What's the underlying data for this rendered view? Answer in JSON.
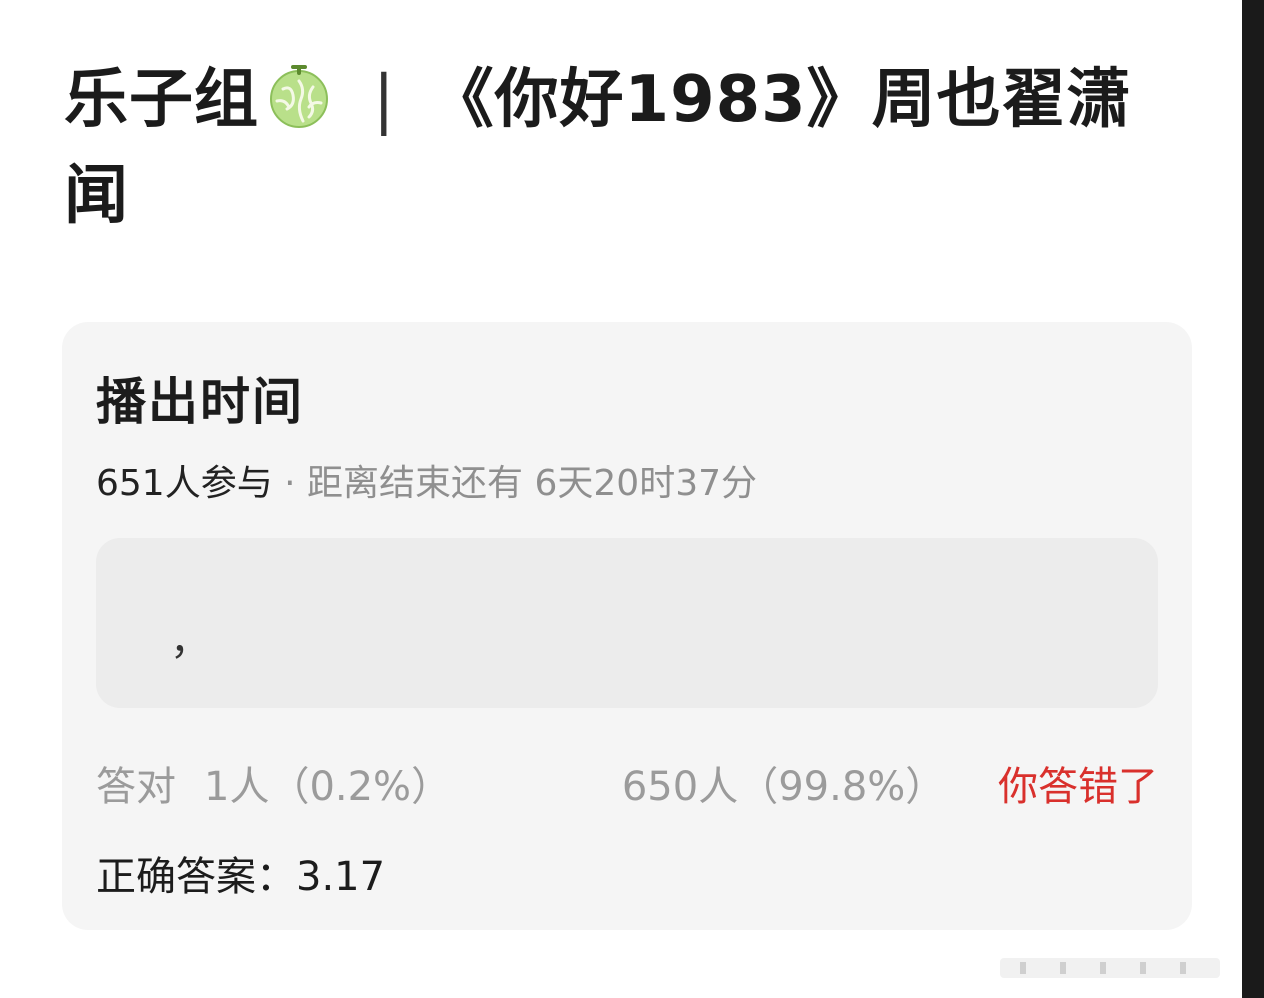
{
  "title": {
    "prefix": "乐子组",
    "icon": "melon-icon",
    "separator": "|",
    "text": "《你好1983》周也翟潇闻"
  },
  "poll": {
    "title": "播出时间",
    "participants": "651人参与",
    "remaining": "· 距离结束还有 6天20时37分",
    "option_text": "，",
    "correct_label": "答对",
    "correct_count": "1人（0.2%）",
    "wrong_count": "650人（99.8%）",
    "wrong_label": "你答错了",
    "answer": "正确答案：3.17"
  },
  "colors": {
    "card_bg": "#f5f5f5",
    "option_bg": "#ececec",
    "wrong_red": "#d9302c",
    "muted_gray": "#9b9b9b"
  }
}
